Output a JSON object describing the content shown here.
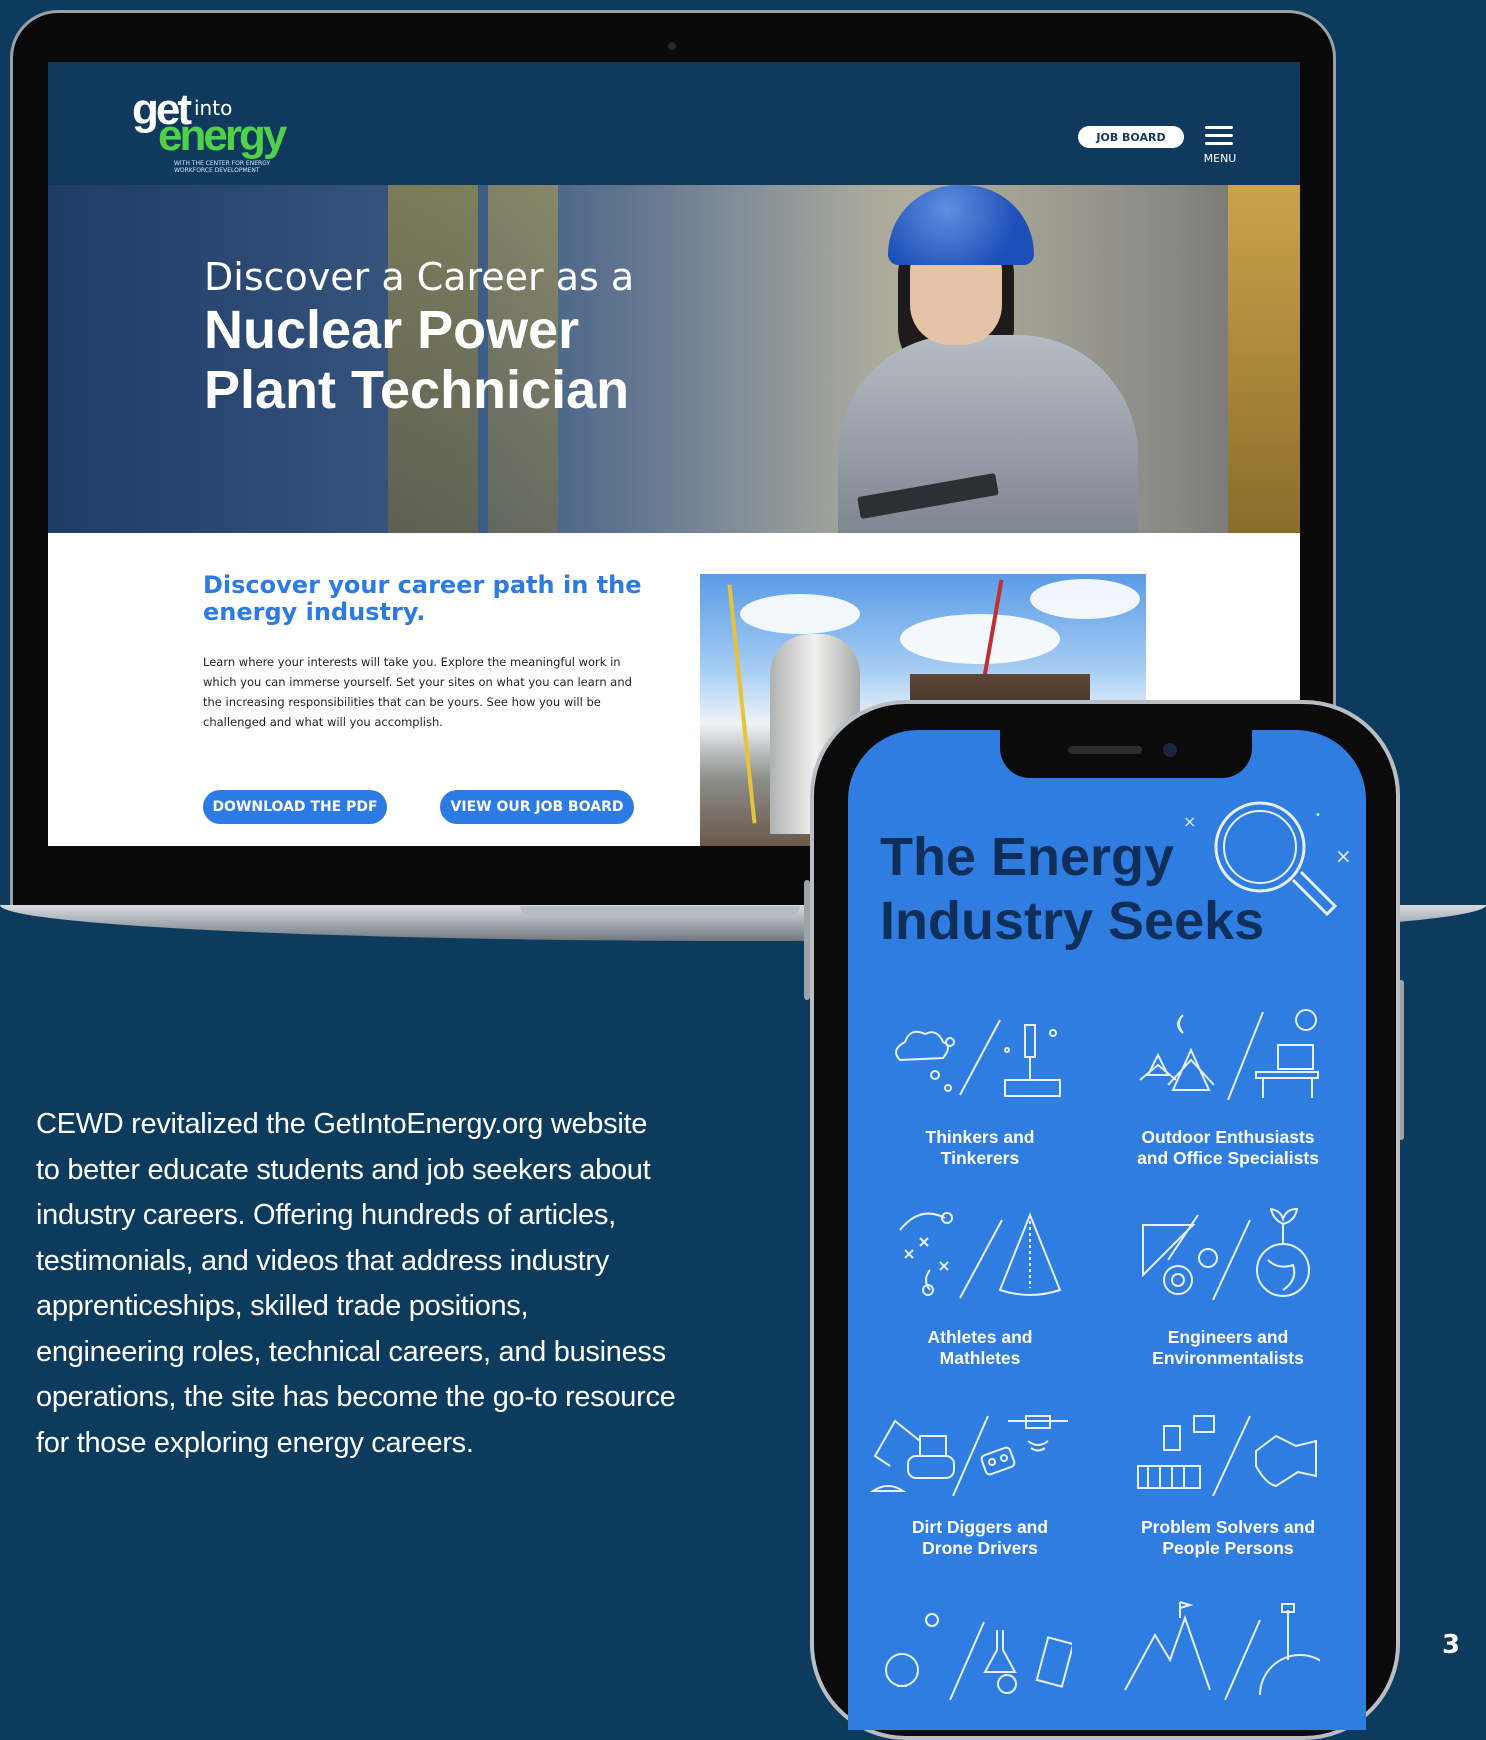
{
  "website": {
    "logo": {
      "get": "get",
      "into": "into",
      "energy": "energy",
      "subtitle": "WITH THE CENTER FOR ENERGY WORKFORCE DEVELOPMENT"
    },
    "header": {
      "job_board_label": "JOB BOARD",
      "menu_label": "MENU"
    },
    "hero": {
      "line1": "Discover a Career as a",
      "line2": "Nuclear Power Plant Technician"
    },
    "content": {
      "title": "Discover your career path in the energy industry.",
      "body": "Learn where your interests will take you. Explore the meaningful work in which you can immerse yourself. Set your sites on what you can learn and the increasing responsibilities that can be yours. See how you will be challenged and what will you accomplish.",
      "download_label": "DOWNLOAD THE PDF",
      "jobs_label": "VIEW OUR JOB BOARD"
    }
  },
  "phone": {
    "title_line1": "The Energy",
    "title_line2": "Industry Seeks",
    "categories": [
      {
        "line1": "Thinkers and",
        "line2": "Tinkerers",
        "icon": "cloud-microscope-icon"
      },
      {
        "line1": "Outdoor Enthusiasts",
        "line2": "and Office Specialists",
        "icon": "trees-desk-icon"
      },
      {
        "line1": "Athletes and",
        "line2": "Mathletes",
        "icon": "play-diagram-cone-icon"
      },
      {
        "line1": "Engineers and",
        "line2": "Environmentalists",
        "icon": "tools-globe-icon"
      },
      {
        "line1": "Dirt Diggers and",
        "line2": "Drone Drivers",
        "icon": "excavator-drone-icon"
      },
      {
        "line1": "Problem Solvers and",
        "line2": "People Persons",
        "icon": "blocks-handshake-icon"
      }
    ]
  },
  "description": "CEWD revitalized the GetIntoEnergy.org website to better educate students and job seekers about industry careers. Offering hundreds of articles, testimonials, and videos that address industry apprenticeships, skilled trade positions, engineering roles, technical careers, and business operations, the site has become the go-to resource for those exploring energy careers.",
  "page_number": "3",
  "colors": {
    "background": "#0d3b5e",
    "accent_blue": "#2c7be5",
    "logo_green": "#4fd14a",
    "phone_title": "#0f2f5a"
  }
}
